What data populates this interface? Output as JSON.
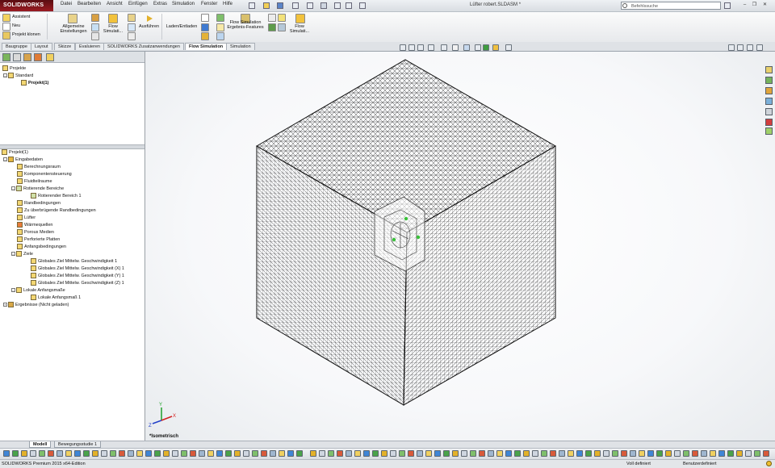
{
  "app": {
    "logo": "SOLIDWORKS",
    "document_title": "Lüfter robert.SLDASM *"
  },
  "menu": [
    "Datei",
    "Bearbeiten",
    "Ansicht",
    "Einfügen",
    "Extras",
    "Simulation",
    "Fenster",
    "Hilfe"
  ],
  "search": {
    "placeholder": "Befehlssuche"
  },
  "command_manager": {
    "assistant": "Assistent",
    "new": "Neu",
    "clone": "Projekt klonen",
    "general_settings": "Allgemeine Einstellungen",
    "flow_simulation_1": "Flow Simulati...",
    "run": "Ausführen",
    "load_unload": "Laden/Entladen",
    "flow_results": "Flow Simulation Ergebnis-Features",
    "flow_simulation_2": "Flow Simulati..."
  },
  "tabs": [
    "Baugruppe",
    "Layout",
    "Skizze",
    "Evaluieren",
    "SOLIDWORKS Zusatzanwendungen",
    "Flow Simulation",
    "Simulation"
  ],
  "active_tab": "Flow Simulation",
  "tree_top": {
    "root": "Projekte",
    "standard": "Standard",
    "project": "Projekt(1)"
  },
  "tree": {
    "root": "Projekt(1)",
    "input": "Eingabedaten",
    "items": [
      "Berechnungsraum",
      "Komponentensteuerung",
      "Fluidteilraume",
      "Rotierende Bereiche",
      "Rotierender Bereich 1",
      "Randbedingungen",
      "Zu überbrügende Randbedingungen",
      "Lüfter",
      "Wärmequellen",
      "Porous Medien",
      "Perforierte Platten",
      "Anfangsbedingungen",
      "Ziele",
      "Globales Ziel Mittelw. Geschwindigkeit 1",
      "Globales Ziel Mittelw. Geschwindigkeit (X) 1",
      "Globales Ziel Mittelw. Geschwindigkeit (Y) 1",
      "Globales Ziel Mittelw. Geschwindigkeit (Z) 1",
      "Lokale Anfangsmaße",
      "Lokale Anfangsmaß 1"
    ],
    "results": "Ergebnisse (Nicht geladen)"
  },
  "viewport": {
    "view_label": "*Isometrisch"
  },
  "model_tabs": [
    "Modell",
    "Bewegungsstudie 1"
  ],
  "active_model_tab": "Modell",
  "status": {
    "edition": "SOLIDWORKS Premium 2015 x64-Edition",
    "definition": "Voll definiert",
    "units": "Benutzerdefiniert"
  },
  "colors": {
    "logo_red": "#9b1b22",
    "mesh": "#222222",
    "triad_x": "#d32020",
    "triad_y": "#1f9f2a",
    "triad_z": "#2340c9",
    "fan_marker": "#3ac23a"
  }
}
